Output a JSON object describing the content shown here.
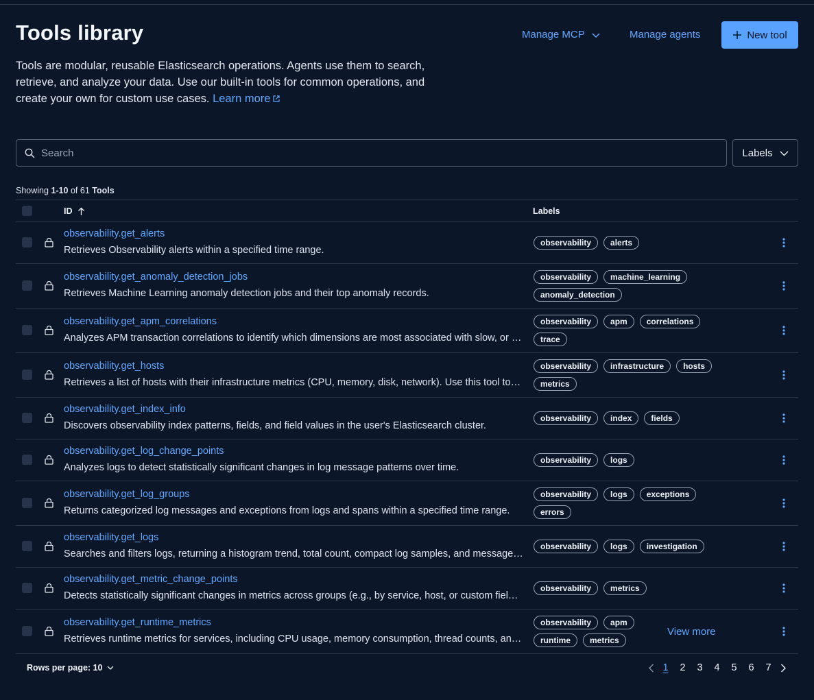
{
  "header": {
    "title": "Tools library",
    "manage_mcp": "Manage MCP",
    "manage_agents": "Manage agents",
    "new_tool": "New tool",
    "description": "Tools are modular, reusable Elasticsearch operations. Agents use them to search, retrieve, and analyze your data. Use our built-in tools for common operations, and create your own for custom use cases.",
    "learn_more": "Learn more"
  },
  "search": {
    "placeholder": "Search",
    "value": ""
  },
  "labels_filter": "Labels",
  "showing": {
    "prefix": "Showing",
    "range": "1-10",
    "of": "of",
    "total": "61",
    "noun": "Tools"
  },
  "table": {
    "columns": {
      "id": "ID",
      "labels": "Labels"
    },
    "rows": [
      {
        "id": "observability.get_alerts",
        "description": "Retrieves Observability alerts within a specified time range.",
        "labels": [
          "observability",
          "alerts"
        ]
      },
      {
        "id": "observability.get_anomaly_detection_jobs",
        "description": "Retrieves Machine Learning anomaly detection jobs and their top anomaly records.",
        "labels": [
          "observability",
          "machine_learning",
          "anomaly_detection"
        ]
      },
      {
        "id": "observability.get_apm_correlations",
        "description": "Analyzes APM transaction correlations to identify which dimensions are most associated with slow, or failed transactions.",
        "labels": [
          "observability",
          "apm",
          "correlations",
          "trace"
        ]
      },
      {
        "id": "observability.get_hosts",
        "description": "Retrieves a list of hosts with their infrastructure metrics (CPU, memory, disk, network). Use this tool to investigate host health.",
        "labels": [
          "observability",
          "infrastructure",
          "hosts",
          "metrics"
        ]
      },
      {
        "id": "observability.get_index_info",
        "description": "Discovers observability index patterns, fields, and field values in the user's Elasticsearch cluster.",
        "labels": [
          "observability",
          "index",
          "fields"
        ]
      },
      {
        "id": "observability.get_log_change_points",
        "description": "Analyzes logs to detect statistically significant changes in log message patterns over time.",
        "labels": [
          "observability",
          "logs"
        ]
      },
      {
        "id": "observability.get_log_groups",
        "description": "Returns categorized log messages and exceptions from logs and spans within a specified time range.",
        "labels": [
          "observability",
          "logs",
          "exceptions",
          "errors"
        ]
      },
      {
        "id": "observability.get_logs",
        "description": "Searches and filters logs, returning a histogram trend, total count, compact log samples, and message categories.",
        "labels": [
          "observability",
          "logs",
          "investigation"
        ]
      },
      {
        "id": "observability.get_metric_change_points",
        "description": "Detects statistically significant changes in metrics across groups (e.g., by service, host, or custom fields).",
        "labels": [
          "observability",
          "metrics"
        ]
      },
      {
        "id": "observability.get_runtime_metrics",
        "description": "Retrieves runtime metrics for services, including CPU usage, memory consumption, thread counts, and more.",
        "labels": [
          "observability",
          "apm",
          "runtime",
          "metrics"
        ],
        "view_more": "View more"
      }
    ]
  },
  "footer": {
    "rows_per_page": "Rows per page: 10",
    "pages": [
      "1",
      "2",
      "3",
      "4",
      "5",
      "6",
      "7"
    ],
    "current_page": "1"
  },
  "icons": [
    "search-icon",
    "chevron-down-icon",
    "plus-icon",
    "external-link-icon",
    "sort-ascending-icon",
    "lock-icon",
    "kebab-menu-icon",
    "chevron-left-icon",
    "chevron-right-icon"
  ],
  "colors": {
    "background": "#0b1628",
    "link": "#62a8ff",
    "primary_button": "#5aa2ff",
    "border": "#2b3649"
  }
}
